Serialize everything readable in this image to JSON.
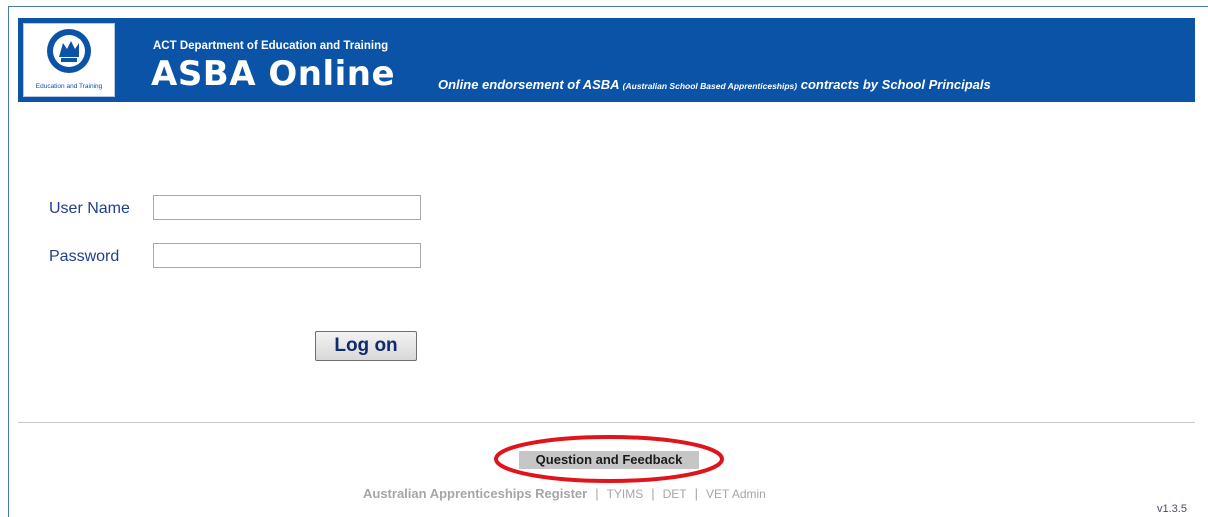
{
  "header": {
    "logo_caption": "Education and Training",
    "department": "ACT Department of Education and Training",
    "title": "ASBA Online",
    "tagline_part1": "Online endorsement of ASBA ",
    "tagline_small": "(Australian School Based Apprenticeships)",
    "tagline_part2": " contracts by School Principals",
    "color": "#0a53a6"
  },
  "login": {
    "username_label": "User Name",
    "username_value": "",
    "password_label": "Password",
    "password_value": "",
    "logon_label": "Log on"
  },
  "feedback": {
    "label": "Question and Feedback",
    "highlight_color": "#e0151c"
  },
  "footer": {
    "links": [
      "Australian Apprenticeships Register",
      "TYIMS",
      "DET",
      "VET Admin"
    ],
    "separator": "|",
    "version": "v1.3.5"
  }
}
